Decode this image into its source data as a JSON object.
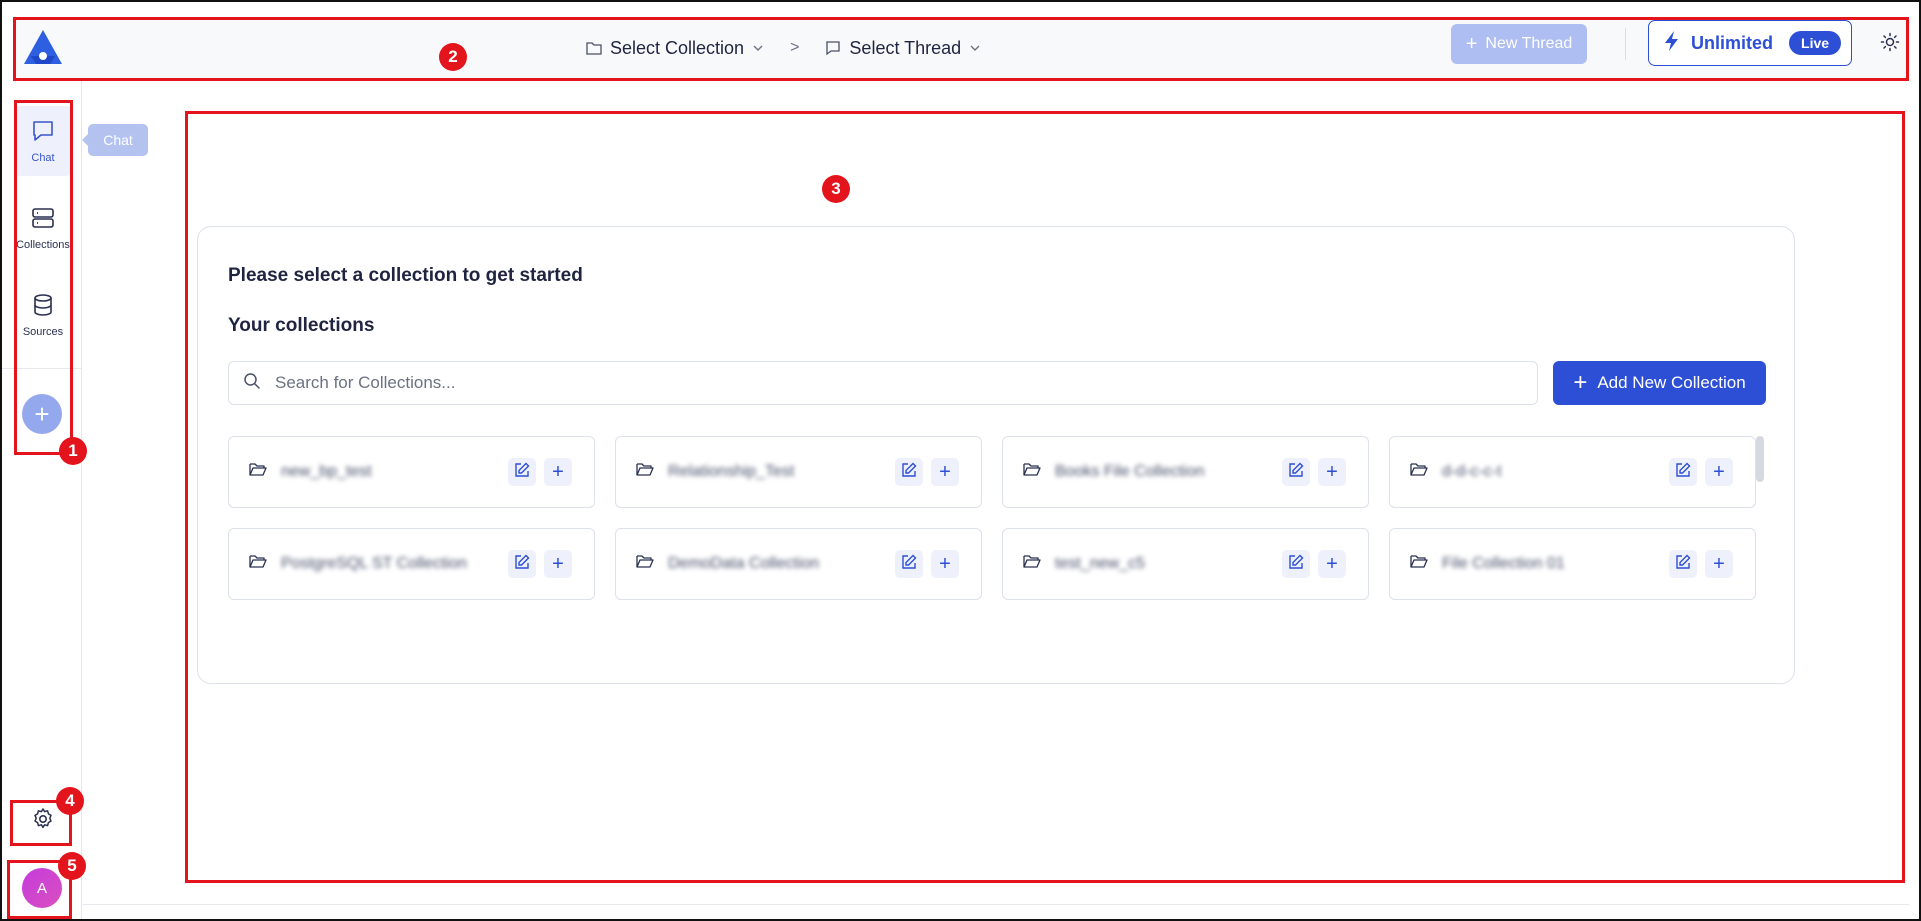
{
  "header": {
    "breadcrumb": {
      "collection_label": "Select Collection",
      "separator": ">",
      "thread_label": "Select Thread"
    },
    "new_thread_label": "New Thread",
    "plan": {
      "label": "Unlimited",
      "badge": "Live"
    }
  },
  "sidebar": {
    "items": [
      {
        "label": "Chat",
        "icon": "chat-bubble-icon",
        "active": true
      },
      {
        "label": "Collections",
        "icon": "server-stack-icon",
        "active": false
      },
      {
        "label": "Sources",
        "icon": "database-icon",
        "active": false
      }
    ],
    "tooltip": "Chat",
    "avatar_initial": "A"
  },
  "main": {
    "prompt": "Please select a collection to get started",
    "section_title": "Your collections",
    "search_placeholder": "Search for Collections...",
    "add_collection_label": "Add New Collection",
    "collections": [
      {
        "name": "new_bp_test"
      },
      {
        "name": "Relationship_Test"
      },
      {
        "name": "Books File Collection"
      },
      {
        "name": "d-d-c-c-t"
      },
      {
        "name": "PostgreSQL ST Collection"
      },
      {
        "name": "DemoData Collection"
      },
      {
        "name": "test_new_c5"
      },
      {
        "name": "File Collection 01"
      }
    ]
  },
  "annotations": [
    "1",
    "2",
    "3",
    "4",
    "5"
  ],
  "colors": {
    "accent": "#2d4fd6",
    "accent_disabled": "#aebdf2",
    "annotation": "#e3141b",
    "avatar": "#c43cdc"
  }
}
